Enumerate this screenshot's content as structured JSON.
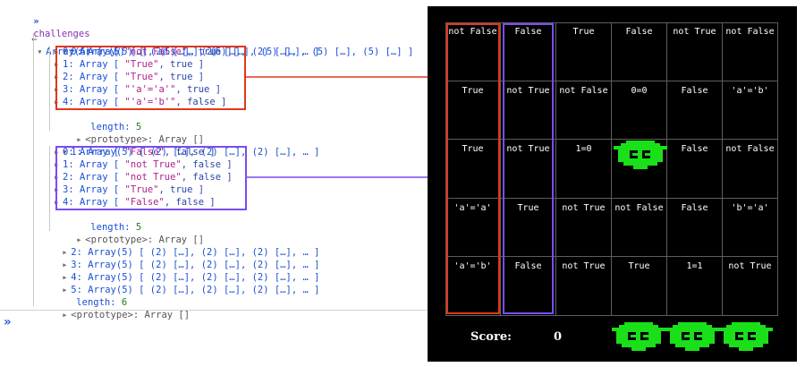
{
  "console": {
    "command": "challenges",
    "root_line": "Array(6) [ (5) […], (5) […], (5) […], (5) […], (5) […], (5) […] ]",
    "root_label": "Array(6)",
    "item0_head": "0: Array(5) [ (2) […], (2) […], (2) […], … ]",
    "item0_children": [
      {
        "idx": "0: Array [ ",
        "s": "\"not False\"",
        "b": ", true ]"
      },
      {
        "idx": "1: Array [ ",
        "s": "\"True\"",
        "b": ", true ]"
      },
      {
        "idx": "2: Array [ ",
        "s": "\"True\"",
        "b": ", true ]"
      },
      {
        "idx": "3: Array [ ",
        "s": "\"'a'='a'\"",
        "b": ", true ]"
      },
      {
        "idx": "4: Array [ ",
        "s": "\"'a'='b'\"",
        "b": ", false ]"
      }
    ],
    "length_label": "length: ",
    "length5": "5",
    "prototype": "<prototype>: Array []",
    "item1_head": "1: Array(5) [ (2) […], (2) […], (2) […], … ]",
    "item1_children": [
      {
        "idx": "0: Array [ ",
        "s": "\"False\"",
        "b": ", false ]"
      },
      {
        "idx": "1: Array [ ",
        "s": "\"not True\"",
        "b": ", false ]"
      },
      {
        "idx": "2: Array [ ",
        "s": "\"not True\"",
        "b": ", false ]"
      },
      {
        "idx": "3: Array [ ",
        "s": "\"True\"",
        "b": ", true ]"
      },
      {
        "idx": "4: Array [ ",
        "s": "\"False\"",
        "b": ", false ]"
      }
    ],
    "item2_head": "2: Array(5) [ (2) […], (2) […], (2) […], … ]",
    "item3_head": "3: Array(5) [ (2) […], (2) […], (2) […], … ]",
    "item4_head": "4: Array(5) [ (2) […], (2) […], (2) […], … ]",
    "item5_head": "5: Array(5) [ (2) […], (2) […], (2) […], … ]",
    "length6": "6",
    "prompt_icon": "double-chevron-right-icon"
  },
  "game": {
    "grid": [
      [
        "not False",
        "False",
        "True",
        "False",
        "not True",
        "not False"
      ],
      [
        "True",
        "not True",
        "not False",
        "0=0",
        "False",
        "'a'='b'"
      ],
      [
        "True",
        "not True",
        "1=0",
        "",
        "False",
        "not False"
      ],
      [
        "'a'='a'",
        "True",
        "not True",
        "not False",
        "False",
        "'b'='a'"
      ],
      [
        "'a'='b'",
        "False",
        "not True",
        "True",
        "1=1",
        "not True"
      ]
    ],
    "score_label": "Score:",
    "score_value": "0",
    "lives": 3,
    "colors": {
      "monster": "#19e019",
      "red_highlight": "#e0381c",
      "purple_highlight": "#7a4df0"
    }
  }
}
